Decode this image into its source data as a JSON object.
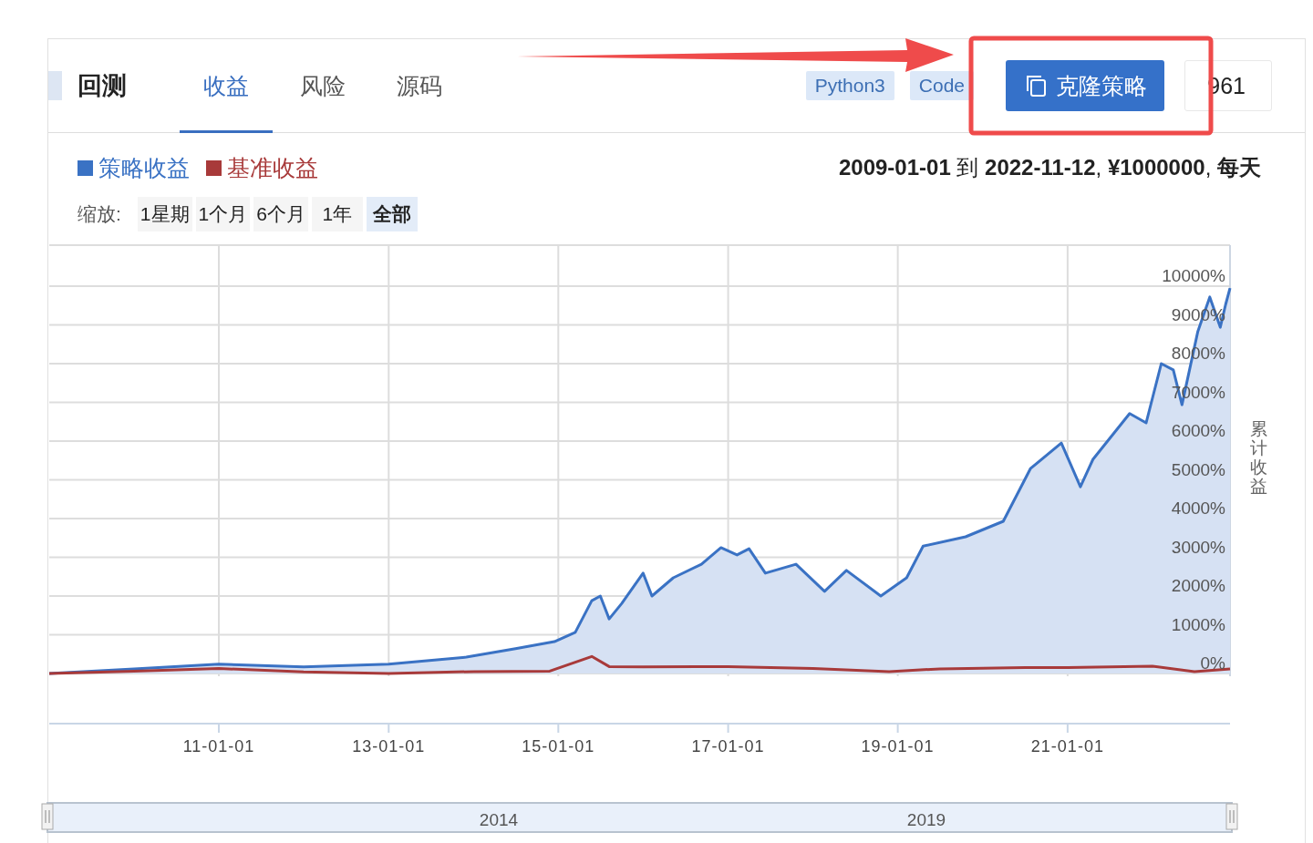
{
  "header": {
    "title": "回测",
    "tabs": [
      {
        "label": "收益",
        "selected": true
      },
      {
        "label": "风险",
        "selected": false
      },
      {
        "label": "源码",
        "selected": false
      }
    ],
    "tags": [
      "Python3",
      "Code"
    ],
    "clone_button": {
      "label": "克隆策略"
    },
    "count": "961"
  },
  "summary": "**2009-01-01** 到 **2022-11-12**, **¥1000000**, **每天**",
  "zoom": {
    "label": "缩放:",
    "options": [
      {
        "label": "1星期",
        "selected": false
      },
      {
        "label": "1个月",
        "selected": false
      },
      {
        "label": "6个月",
        "selected": false
      },
      {
        "label": "1年",
        "selected": false
      },
      {
        "label": "全部",
        "selected": true
      }
    ]
  },
  "chart_data": {
    "type": "line",
    "grid": true,
    "ylabel": "累计收益",
    "xlim": [
      "2009-01-01",
      "2022-12-01"
    ],
    "ylim": [
      0,
      10000
    ],
    "xticks": [
      {
        "value": "2011-01-01",
        "label": "11-01-01"
      },
      {
        "value": "2013-01-01",
        "label": "13-01-01"
      },
      {
        "value": "2015-01-01",
        "label": "15-01-01"
      },
      {
        "value": "2017-01-01",
        "label": "17-01-01"
      },
      {
        "value": "2019-01-01",
        "label": "19-01-01"
      },
      {
        "value": "2021-01-01",
        "label": "21-01-01"
      }
    ],
    "yticks": [
      {
        "value": 0,
        "label": "0%"
      },
      {
        "value": 1000,
        "label": "1000%"
      },
      {
        "value": 2000,
        "label": "2000%"
      },
      {
        "value": 3000,
        "label": "3000%"
      },
      {
        "value": 4000,
        "label": "4000%"
      },
      {
        "value": 5000,
        "label": "5000%"
      },
      {
        "value": 6000,
        "label": "6000%"
      },
      {
        "value": 7000,
        "label": "7000%"
      },
      {
        "value": 8000,
        "label": "8000%"
      },
      {
        "value": 9000,
        "label": "9000%"
      },
      {
        "value": 10000,
        "label": "10000%"
      }
    ],
    "series": [
      {
        "name": "策略收益",
        "type": "area",
        "color": "#3a72c4",
        "x": [
          "2009-01-01",
          "2010-01-01",
          "2011-01-01",
          "2012-01-01",
          "2013-01-01",
          "2013-12-01",
          "2014-07-01",
          "2014-12-15",
          "2015-03-15",
          "2015-05-25",
          "2015-07-01",
          "2015-08-08",
          "2015-10-01",
          "2016-01-01",
          "2016-02-08",
          "2016-05-10",
          "2016-09-08",
          "2016-12-01",
          "2017-02-08",
          "2017-04-01",
          "2017-06-10",
          "2017-10-20",
          "2018-02-20",
          "2018-05-25",
          "2018-10-20",
          "2019-02-08",
          "2019-04-20",
          "2019-10-20",
          "2020-03-30",
          "2020-07-25",
          "2020-12-05",
          "2021-02-25",
          "2021-04-20",
          "2021-09-25",
          "2021-12-05",
          "2022-02-08",
          "2022-04-01",
          "2022-05-08",
          "2022-07-15",
          "2022-09-05",
          "2022-10-20",
          "2022-11-12",
          "2022-12-01"
        ],
        "values": [
          0,
          120,
          240,
          170,
          240,
          420,
          640,
          820,
          1060,
          1880,
          2000,
          1410,
          1810,
          2590,
          2000,
          2470,
          2820,
          3250,
          3060,
          3220,
          2590,
          2820,
          2120,
          2660,
          2000,
          2470,
          3290,
          3530,
          3930,
          5290,
          5950,
          4820,
          5530,
          6710,
          6470,
          8000,
          7840,
          6940,
          8820,
          9720,
          8940,
          9530,
          9950
        ]
      },
      {
        "name": "基准收益",
        "color": "#a83a3a",
        "x": [
          "2009-01-01",
          "2010-01-01",
          "2011-01-01",
          "2012-01-01",
          "2013-01-01",
          "2014-01-01",
          "2014-11-25",
          "2015-05-25",
          "2015-08-08",
          "2016-01-01",
          "2017-01-01",
          "2018-01-01",
          "2018-11-25",
          "2019-07-01",
          "2020-07-01",
          "2021-01-01",
          "2022-01-01",
          "2022-07-01",
          "2022-12-01"
        ],
        "values": [
          0,
          60,
          130,
          40,
          0,
          50,
          60,
          440,
          180,
          170,
          180,
          130,
          50,
          120,
          150,
          150,
          190,
          50,
          120
        ]
      }
    ]
  },
  "navigator": {
    "labels": [
      "2014",
      "2019"
    ]
  }
}
